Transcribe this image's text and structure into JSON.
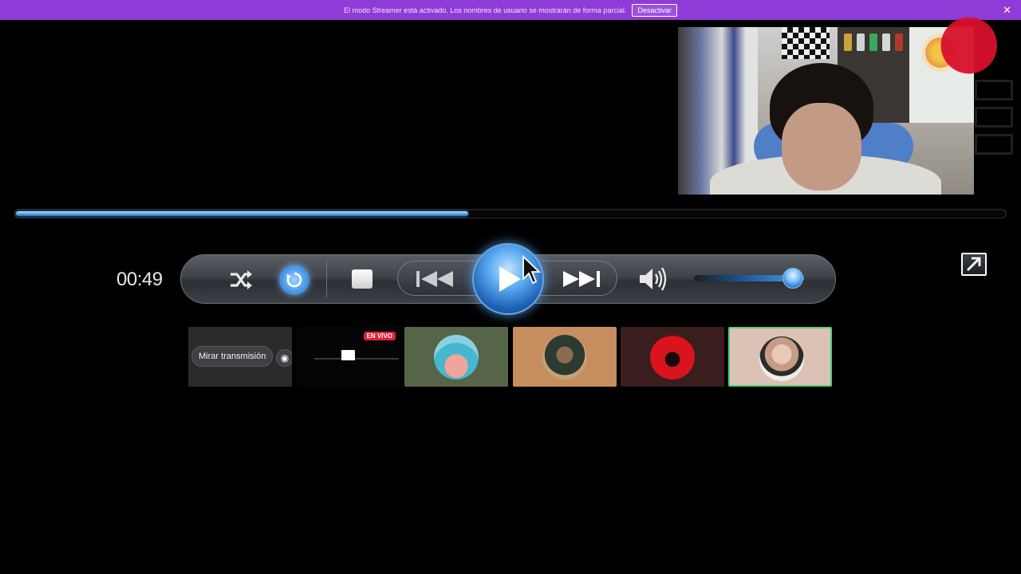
{
  "banner": {
    "message": "El modo Streamer está activado. Los nombres de usuario se mostrarán de forma parcial.",
    "deactivate_label": "Desactivar",
    "close_glyph": "✕"
  },
  "player": {
    "time": "00:49",
    "progress": 0.457,
    "volume": 0.9,
    "accent_color": "#4a9ff0"
  },
  "icons": {
    "shuffle": "shuffle-icon",
    "repeat": "repeat-icon",
    "stop": "stop-icon",
    "previous": "previous-icon",
    "play": "play-icon",
    "next": "next-icon",
    "volume": "volume-icon",
    "popout": "popout-icon"
  },
  "participants": [
    {
      "type": "action",
      "label": "Mirar transmisión"
    },
    {
      "type": "screen",
      "badge": "EN VIVO"
    },
    {
      "type": "avatar",
      "icon": "cartoon-starfish-avatar"
    },
    {
      "type": "avatar",
      "icon": "person-cap-avatar"
    },
    {
      "type": "avatar",
      "icon": "red-demon-avatar"
    },
    {
      "type": "avatar",
      "icon": "bald-man-avatar",
      "speaking": true
    }
  ]
}
